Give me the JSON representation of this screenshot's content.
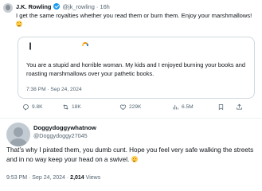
{
  "tweet": {
    "author_name": "J.K. Rowling",
    "handle": "@jk_rowling",
    "separator": "·",
    "age": "16h",
    "text": "I get the same royalties whether you read them or burn them. Enjoy your marshmallows!",
    "emoji_icon": "smiling-emoji-icon",
    "quoted": {
      "text": "You are a stupid and horrible woman. My kids and I enjoyed burning your books and roasting marshmallows over your pathetic books.",
      "timestamp": "7:38 PM · Sep 24, 2024"
    },
    "actions": {
      "replies": "9.8K",
      "reposts": "18K",
      "likes": "229K",
      "views": "6.5M"
    }
  },
  "reply": {
    "author_name": "Doggydoggywhatnow",
    "handle": "@Doggydoggy27045",
    "text": "That’s why I pirated them, you dumb cunt. Hope you feel very safe walking the streets and in no way keep your head on a swivel.",
    "timestamp": "9:53 PM · Sep 24, 2024 ·",
    "views": "2,014",
    "views_label": "Views"
  },
  "colors": {
    "accent": "#1d9bf0",
    "muted": "#536471",
    "border": "#cfd9de"
  }
}
